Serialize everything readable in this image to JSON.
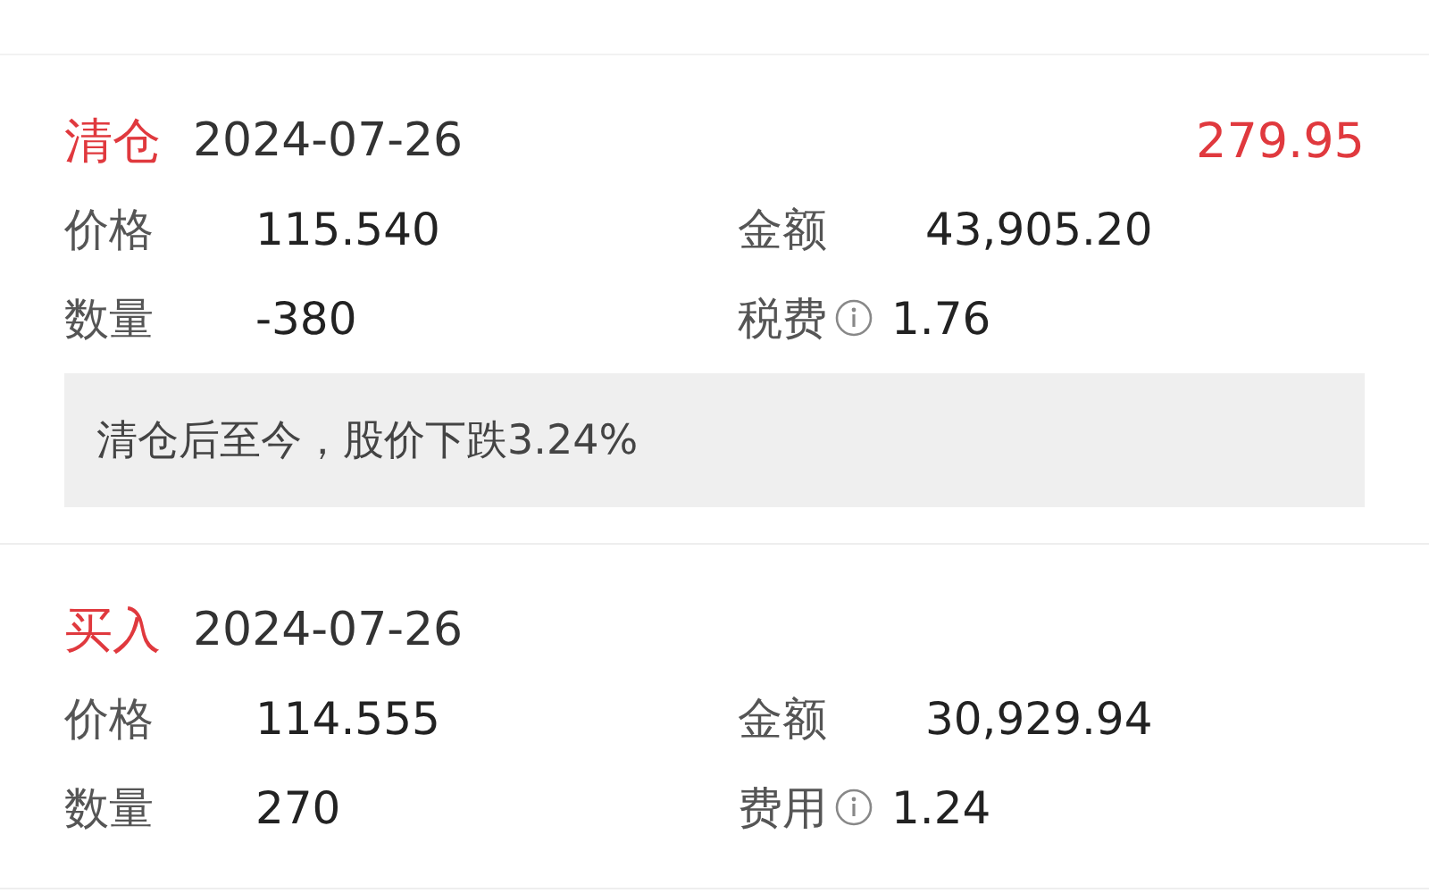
{
  "records": [
    {
      "type": "清仓",
      "date": "2024-07-26",
      "amount": "279.95",
      "fields": [
        {
          "label": "价格",
          "value": "115.540",
          "info": false
        },
        {
          "label": "金额",
          "value": "43,905.20",
          "info": false
        },
        {
          "label": "数量",
          "value": "-380",
          "info": false
        },
        {
          "label": "税费",
          "value": "1.76",
          "info": true
        }
      ],
      "note": "清仓后至今，股价下跌3.24%"
    },
    {
      "type": "买入",
      "date": "2024-07-26",
      "fields": [
        {
          "label": "价格",
          "value": "114.555",
          "info": false
        },
        {
          "label": "金额",
          "value": "30,929.94",
          "info": false
        },
        {
          "label": "数量",
          "value": "270",
          "info": false
        },
        {
          "label": "费用",
          "value": "1.24",
          "info": true
        }
      ]
    }
  ]
}
